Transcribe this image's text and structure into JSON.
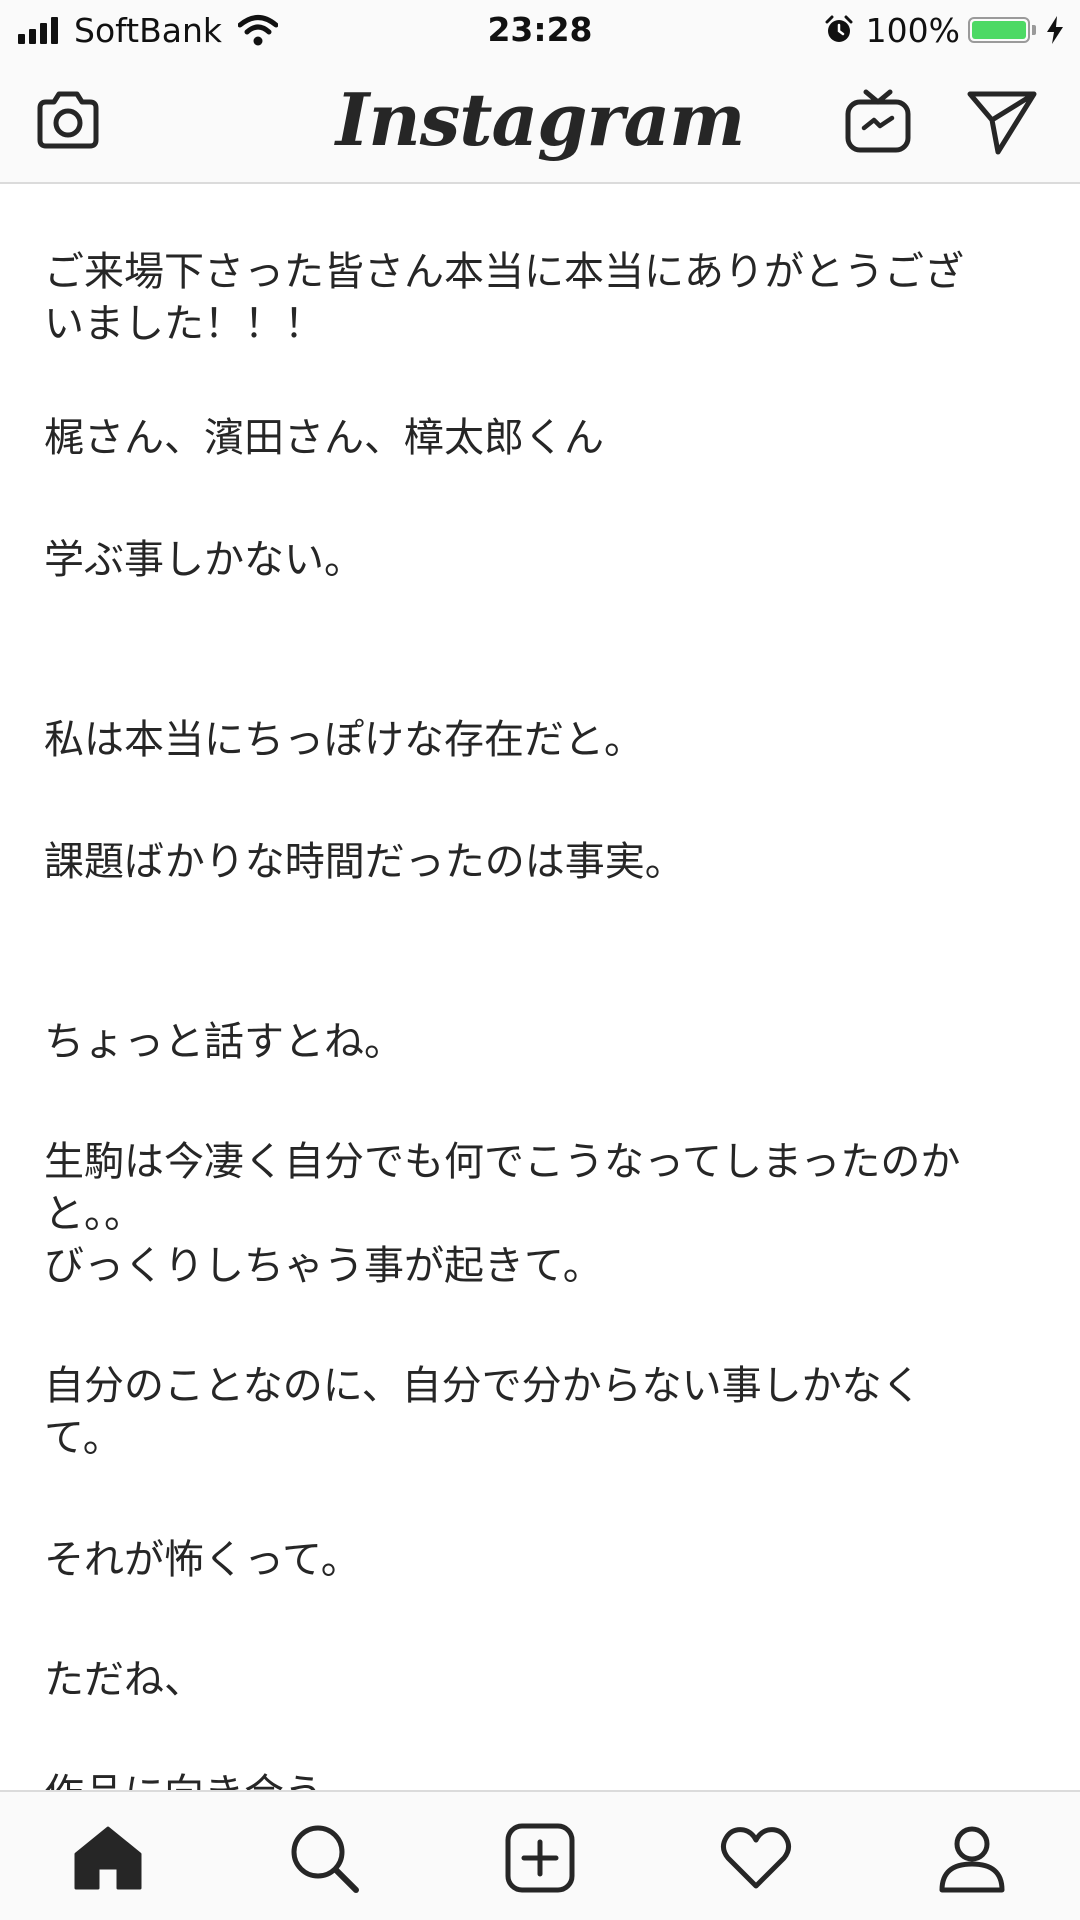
{
  "status_bar": {
    "carrier": "SoftBank",
    "time": "23:28",
    "battery_percent": "100%",
    "battery_level": 1.0,
    "icons": [
      "signal-icon",
      "wifi-icon",
      "alarm-icon",
      "battery-icon",
      "charging-icon"
    ]
  },
  "nav": {
    "logo": "Instagram",
    "icons": [
      "camera-icon",
      "igtv-icon",
      "direct-message-icon"
    ]
  },
  "post": {
    "paragraphs": [
      "ご来場下さった皆さん本当に本当にありがとうござ\nいました！！！",
      "梶さん、濱田さん、樟太郎くん",
      "学ぶ事しかない。",
      "私は本当にちっぽけな存在だと。",
      "課題ばかりな時間だったのは事実。",
      "ちょっと話すとね。",
      "生駒は今凄く自分でも何でこうなってしまったのか\nと。。\nびっくりしちゃう事が起きて。",
      "自分のことなのに、自分で分からない事しかなく\nて。",
      "それが怖くって。",
      "ただね、",
      "作品に向き合う"
    ]
  },
  "tab_bar": {
    "icons": [
      "home-icon",
      "search-icon",
      "new-post-icon",
      "activity-heart-icon",
      "profile-icon"
    ]
  }
}
